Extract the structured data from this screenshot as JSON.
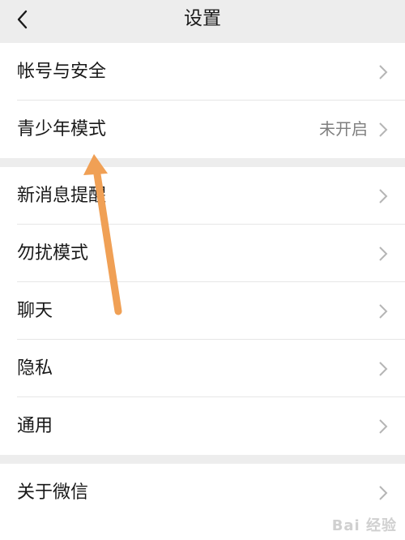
{
  "header": {
    "title": "设置",
    "back_icon": "chevron-left-icon"
  },
  "groups": [
    {
      "rows": [
        {
          "label": "帐号与安全",
          "value": ""
        },
        {
          "label": "青少年模式",
          "value": "未开启"
        }
      ]
    },
    {
      "rows": [
        {
          "label": "新消息提醒"
        },
        {
          "label": "勿扰模式"
        },
        {
          "label": "聊天"
        },
        {
          "label": "隐私"
        },
        {
          "label": "通用"
        }
      ]
    },
    {
      "rows": [
        {
          "label": "关于微信"
        }
      ]
    }
  ],
  "annotation": {
    "color": "#f0a055",
    "icon": "orange-arrow-annotation"
  },
  "watermark": "Bai 经验"
}
